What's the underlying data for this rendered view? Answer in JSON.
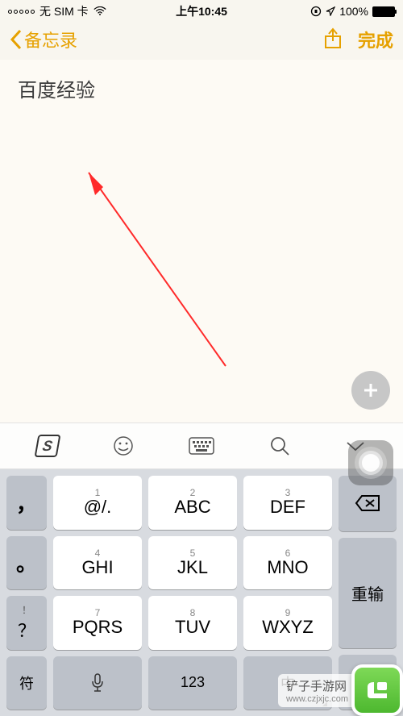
{
  "status": {
    "sim": "无 SIM 卡",
    "time": "上午10:45",
    "battery": "100%"
  },
  "nav": {
    "back_label": "备忘录",
    "done_label": "完成"
  },
  "note": {
    "content": "百度经验"
  },
  "kb_toolbar": {
    "logo": "S"
  },
  "keyboard": {
    "left": {
      "r1": "，",
      "r2": "。",
      "r3_small": "！",
      "r3": "？",
      "r4": "符"
    },
    "mid": {
      "row1": [
        {
          "small": "1",
          "main": "@/."
        },
        {
          "small": "2",
          "main": "ABC"
        },
        {
          "small": "3",
          "main": "DEF"
        }
      ],
      "row2": [
        {
          "small": "4",
          "main": "GHI"
        },
        {
          "small": "5",
          "main": "JKL"
        },
        {
          "small": "6",
          "main": "MNO"
        }
      ],
      "row3": [
        {
          "small": "7",
          "main": "PQRS"
        },
        {
          "small": "8",
          "main": "TUV"
        },
        {
          "small": "9",
          "main": "WXYZ"
        }
      ],
      "row4": {
        "mic": "",
        "num": "123",
        "zh": "中"
      }
    },
    "right": {
      "delete": "",
      "reinput": "重输",
      "blank": ""
    }
  },
  "watermark": {
    "text": "铲子手游网",
    "url": "www.czjxjc.com"
  }
}
